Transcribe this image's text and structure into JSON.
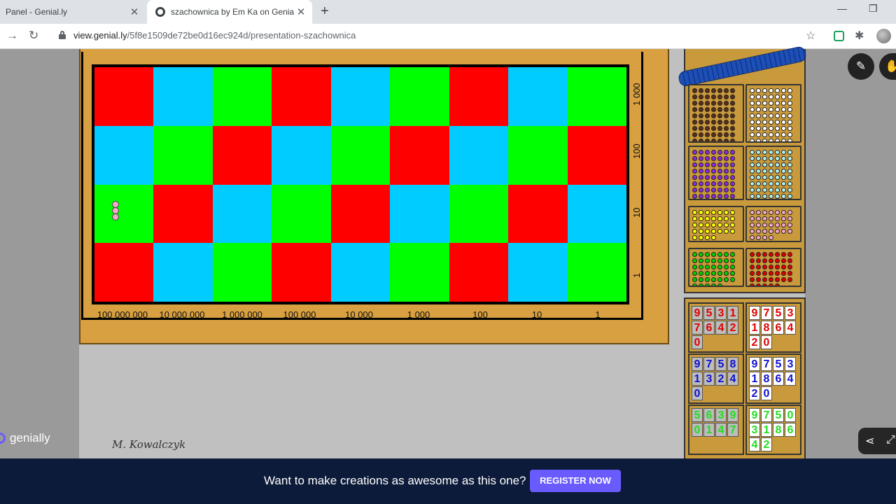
{
  "browser": {
    "tabs": [
      {
        "label": "Panel - Genial.ly",
        "active": false
      },
      {
        "label": "szachownica by Em Ka on Genially",
        "active": true
      }
    ],
    "url_domain": "view.genial.ly",
    "url_path": "/5f8e1509de72be0d16ec924d/presentation-szachownica",
    "icons": [
      "back-arrow-icon",
      "reload-icon",
      "lock-icon",
      "star-icon",
      "extension-icon",
      "puzzle-icon",
      "profile-avatar",
      "minimize-icon",
      "restore-icon"
    ]
  },
  "board": {
    "columns": [
      "100 000 000",
      "10 000 000",
      "1 000 000",
      "100 000",
      "10 000",
      "1 000",
      "100",
      "10",
      "1"
    ],
    "rows": [
      "1 000",
      "100",
      "10",
      "1"
    ],
    "colors": {
      "red": "#ff0000",
      "blue": "#00ccff",
      "green": "#00ff00"
    },
    "row_pattern": [
      [
        "r",
        "b",
        "g",
        "r",
        "b",
        "g",
        "r",
        "b",
        "g"
      ],
      [
        "b",
        "g",
        "r",
        "b",
        "g",
        "r",
        "b",
        "g",
        "r"
      ],
      [
        "g",
        "r",
        "b",
        "g",
        "r",
        "b",
        "g",
        "r",
        "b"
      ],
      [
        "r",
        "b",
        "g",
        "r",
        "b",
        "g",
        "r",
        "b",
        "g"
      ]
    ],
    "bead_chain_count": 3
  },
  "bead_trays": [
    {
      "name": "brown",
      "color": "#5a2e1a"
    },
    {
      "name": "white",
      "color": "#ffffff"
    },
    {
      "name": "purple",
      "color": "#8a2be2"
    },
    {
      "name": "light-blue",
      "color": "#aef0f0"
    },
    {
      "name": "yellow",
      "color": "#ffff00"
    },
    {
      "name": "pink",
      "color": "#f4a8cc"
    },
    {
      "name": "green",
      "color": "#00d000"
    },
    {
      "name": "red",
      "color": "#e00000"
    }
  ],
  "card_trays": [
    {
      "color": "#e00000",
      "style": "grey",
      "digits": [
        "9",
        "5",
        "3",
        "1",
        "7",
        "6",
        "4",
        "2",
        "0"
      ]
    },
    {
      "color": "#e00000",
      "style": "white",
      "digits": [
        "9",
        "7",
        "5",
        "3",
        "1",
        "8",
        "6",
        "4",
        "2",
        "0"
      ]
    },
    {
      "color": "#1010d0",
      "style": "grey",
      "digits": [
        "9",
        "7",
        "5",
        "8",
        "1",
        "3",
        "2",
        "4",
        "0"
      ]
    },
    {
      "color": "#1010d0",
      "style": "white",
      "digits": [
        "9",
        "7",
        "5",
        "3",
        "1",
        "8",
        "6",
        "4",
        "2",
        "0"
      ]
    },
    {
      "color": "#22dd22",
      "style": "grey",
      "digits": [
        "5",
        "6",
        "3",
        "9",
        "0",
        "1",
        "4",
        "7"
      ]
    },
    {
      "color": "#22dd22",
      "style": "white",
      "digits": [
        "9",
        "7",
        "5",
        "0",
        "3",
        "1",
        "8",
        "6",
        "4",
        "2"
      ]
    }
  ],
  "signature": "M. Kowalczyk",
  "genially_logo": "genially",
  "banner": {
    "text": "Want to make creations as awesome as this one?",
    "button": "REGISTER NOW"
  }
}
